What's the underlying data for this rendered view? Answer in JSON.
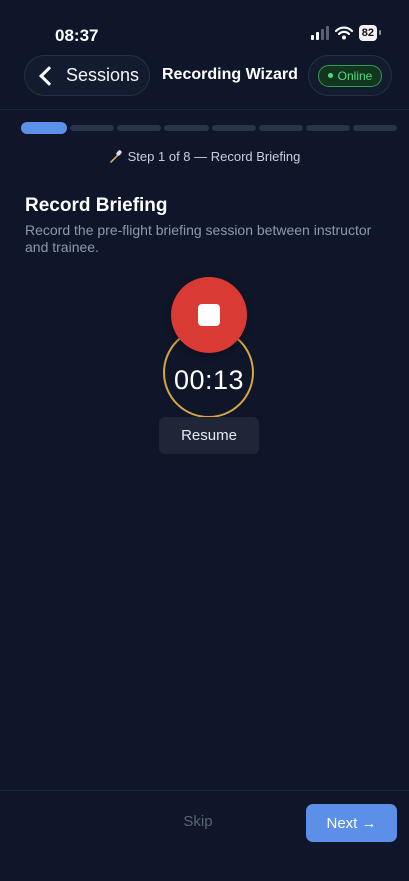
{
  "status_bar": {
    "time": "08:37",
    "battery": "82"
  },
  "nav": {
    "back_label": "Sessions",
    "title": "Recording Wizard",
    "status": "Online"
  },
  "wizard": {
    "current_step": 1,
    "total_steps": 8,
    "step_label": "Step 1 of 8 — Record Briefing"
  },
  "section": {
    "title": "Record Briefing",
    "description": "Record the pre-flight briefing session between instructor and trainee."
  },
  "recorder": {
    "timer": "00:13",
    "resume_label": "Resume"
  },
  "footer": {
    "skip_label": "Skip",
    "next_label": "Next →"
  },
  "colors": {
    "background": "#0f1629",
    "accent": "#5b8fe8",
    "record": "#d93a34",
    "ring": "#d9a441",
    "online": "#4ade80"
  },
  "icons": [
    "chevron-left-icon",
    "signal-icon",
    "wifi-icon",
    "battery-icon",
    "microphone-icon",
    "stop-icon"
  ]
}
